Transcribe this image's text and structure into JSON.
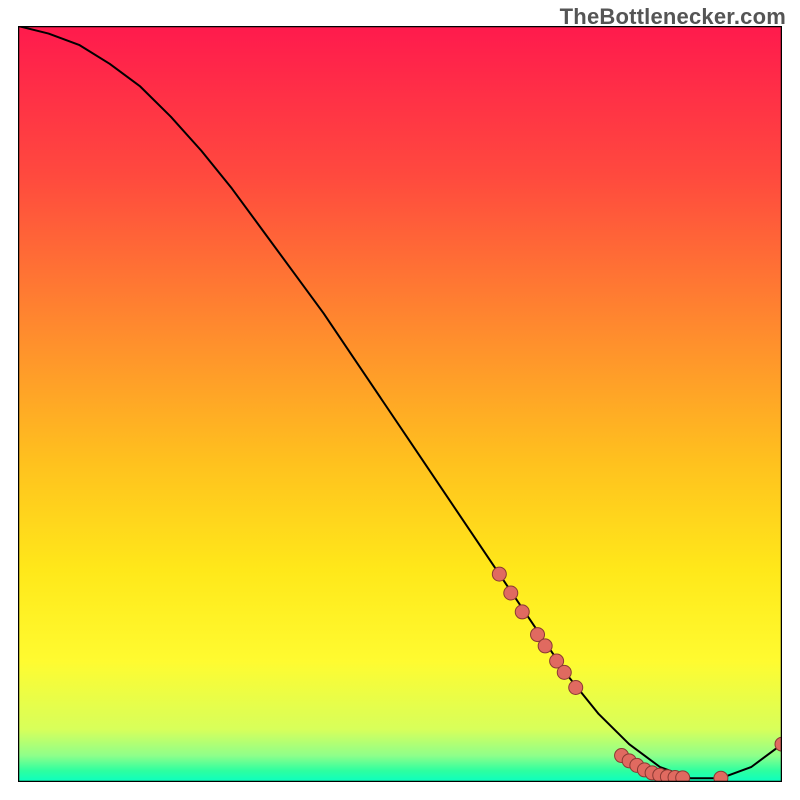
{
  "credit": "TheBottlenecker.com",
  "chart_data": {
    "type": "line",
    "title": "",
    "xlabel": "",
    "ylabel": "",
    "xlim": [
      0,
      100
    ],
    "ylim": [
      0,
      100
    ],
    "grid": false,
    "series": [
      {
        "name": "curve",
        "x": [
          0,
          4,
          8,
          12,
          16,
          20,
          24,
          28,
          32,
          36,
          40,
          44,
          48,
          52,
          56,
          60,
          64,
          68,
          72,
          76,
          80,
          84,
          88,
          92,
          96,
          100
        ],
        "y": [
          100,
          99,
          97.5,
          95,
          92,
          88,
          83.5,
          78.5,
          73,
          67.5,
          62,
          56,
          50,
          44,
          38,
          32,
          26,
          20,
          14,
          9,
          5,
          2,
          0.5,
          0.5,
          2,
          5
        ]
      }
    ],
    "markers": [
      {
        "name": "points",
        "x": [
          63,
          64.5,
          66,
          68,
          69,
          70.5,
          71.5,
          73,
          79,
          80,
          81,
          82,
          83,
          84,
          85,
          86,
          87,
          92,
          100
        ],
        "y": [
          27.5,
          25,
          22.5,
          19.5,
          18,
          16,
          14.5,
          12.5,
          3.5,
          2.8,
          2.2,
          1.6,
          1.2,
          0.9,
          0.7,
          0.6,
          0.55,
          0.5,
          5
        ]
      }
    ],
    "gradient_stops": [
      {
        "offset": 0.0,
        "color": "#ff1a4d"
      },
      {
        "offset": 0.2,
        "color": "#ff4a3e"
      },
      {
        "offset": 0.4,
        "color": "#ff8a2e"
      },
      {
        "offset": 0.58,
        "color": "#ffc21e"
      },
      {
        "offset": 0.72,
        "color": "#ffe81a"
      },
      {
        "offset": 0.84,
        "color": "#fffb30"
      },
      {
        "offset": 0.93,
        "color": "#d8ff5a"
      },
      {
        "offset": 0.965,
        "color": "#8fff8a"
      },
      {
        "offset": 0.985,
        "color": "#2effa0"
      },
      {
        "offset": 1.0,
        "color": "#0affc2"
      }
    ],
    "frame_color": "#000000",
    "line_color": "#000000",
    "marker_color": "#e06a60",
    "marker_stroke": "#8a3a33"
  }
}
